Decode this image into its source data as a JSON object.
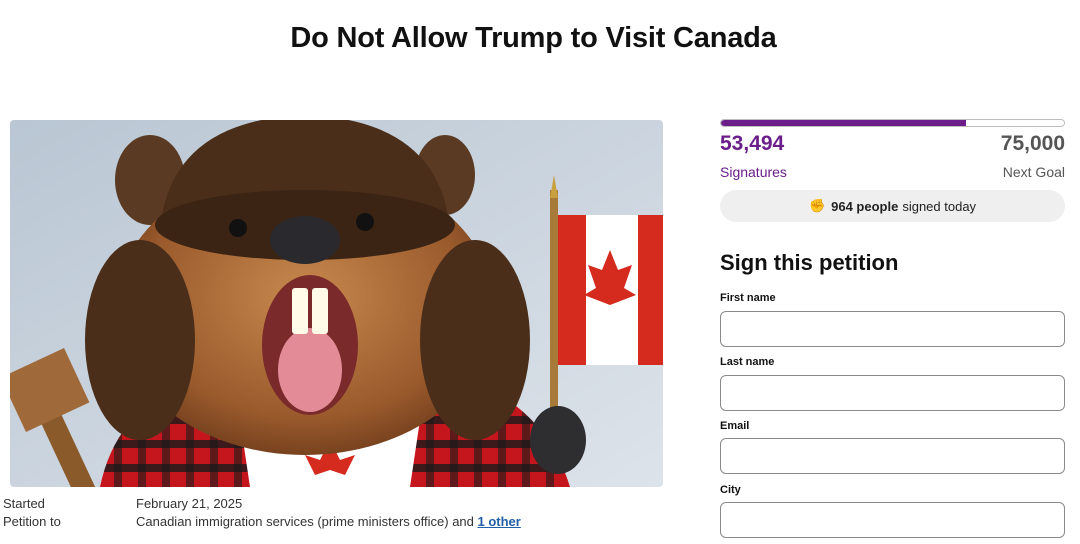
{
  "title": "Do Not Allow Trump to Visit Canada",
  "meta": {
    "started_label": "Started",
    "started_value": "February 21, 2025",
    "petition_to_label": "Petition to",
    "petition_to_value": "Canadian immigration services (prime ministers office) and ",
    "petition_to_link": "1 other"
  },
  "progress": {
    "signatures": "53,494",
    "signatures_label": "Signatures",
    "goal": "75,000",
    "goal_label": "Next Goal",
    "fraction": 0.713,
    "color": "#6b1d8a"
  },
  "today": {
    "icon": "raised-fist-icon",
    "count_text": "964 people",
    "suffix": "signed today"
  },
  "form": {
    "heading": "Sign this petition",
    "fields": [
      {
        "label": "First name",
        "value": "",
        "placeholder": ""
      },
      {
        "label": "Last name",
        "value": "",
        "placeholder": ""
      },
      {
        "label": "Email",
        "value": "",
        "placeholder": ""
      },
      {
        "label": "City",
        "value": "",
        "placeholder": ""
      }
    ]
  }
}
